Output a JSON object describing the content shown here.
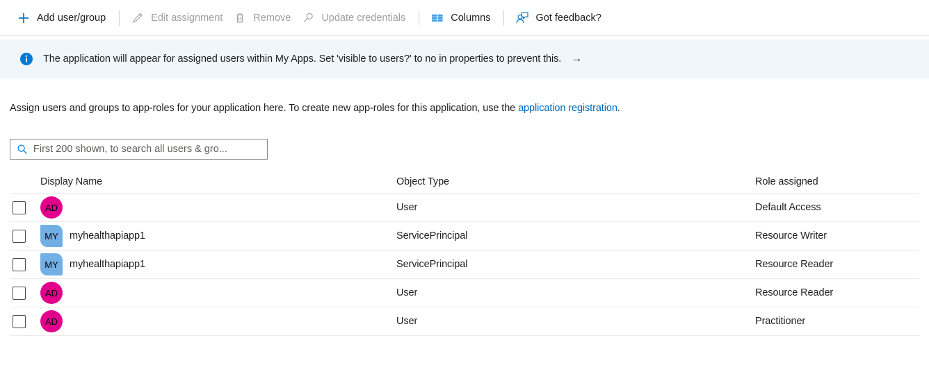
{
  "toolbar": {
    "items": [
      {
        "label": "Add user/group",
        "icon": "plus-icon",
        "disabled": false,
        "name": "add-user-group-button"
      },
      {
        "label": "Edit assignment",
        "icon": "pencil-icon",
        "disabled": true,
        "name": "edit-assignment-button"
      },
      {
        "label": "Remove",
        "icon": "trash-icon",
        "disabled": true,
        "name": "remove-button"
      },
      {
        "label": "Update credentials",
        "icon": "key-icon",
        "disabled": true,
        "name": "update-credentials-button"
      },
      {
        "label": "Columns",
        "icon": "columns-icon",
        "disabled": false,
        "name": "columns-button"
      },
      {
        "label": "Got feedback?",
        "icon": "feedback-person-icon",
        "disabled": false,
        "name": "got-feedback-button"
      }
    ]
  },
  "banner": {
    "icon": "info-icon",
    "text": "The application will appear for assigned users within My Apps. Set 'visible to users?' to no in properties to prevent this.",
    "arrow": "→",
    "background": "#eff6fc"
  },
  "description": {
    "before_link": "Assign users and groups to app-roles for your application here. To create new app-roles for this application, use the ",
    "link_text": "application registration",
    "after_link": ".",
    "link_color": "#0069bb"
  },
  "search": {
    "icon": "search-icon",
    "placeholder": "First 200 shown, to search all users & gro...",
    "value": ""
  },
  "table": {
    "columns": [
      "Display Name",
      "Object Type",
      "Role assigned"
    ],
    "rows": [
      {
        "avatar_initials": "AD",
        "avatar_shape": "circle",
        "avatar_color": "#e3008c",
        "display_name": "",
        "object_type": "User",
        "role_assigned": "Default Access"
      },
      {
        "avatar_initials": "MY",
        "avatar_shape": "square",
        "avatar_color": "#71afe5",
        "display_name": "myhealthapiapp1",
        "object_type": "ServicePrincipal",
        "role_assigned": "Resource Writer"
      },
      {
        "avatar_initials": "MY",
        "avatar_shape": "square",
        "avatar_color": "#71afe5",
        "display_name": "myhealthapiapp1",
        "object_type": "ServicePrincipal",
        "role_assigned": "Resource Reader"
      },
      {
        "avatar_initials": "AD",
        "avatar_shape": "circle",
        "avatar_color": "#e3008c",
        "display_name": "",
        "object_type": "User",
        "role_assigned": "Resource Reader"
      },
      {
        "avatar_initials": "AD",
        "avatar_shape": "circle",
        "avatar_color": "#e3008c",
        "display_name": "",
        "object_type": "User",
        "role_assigned": "Practitioner"
      }
    ]
  }
}
